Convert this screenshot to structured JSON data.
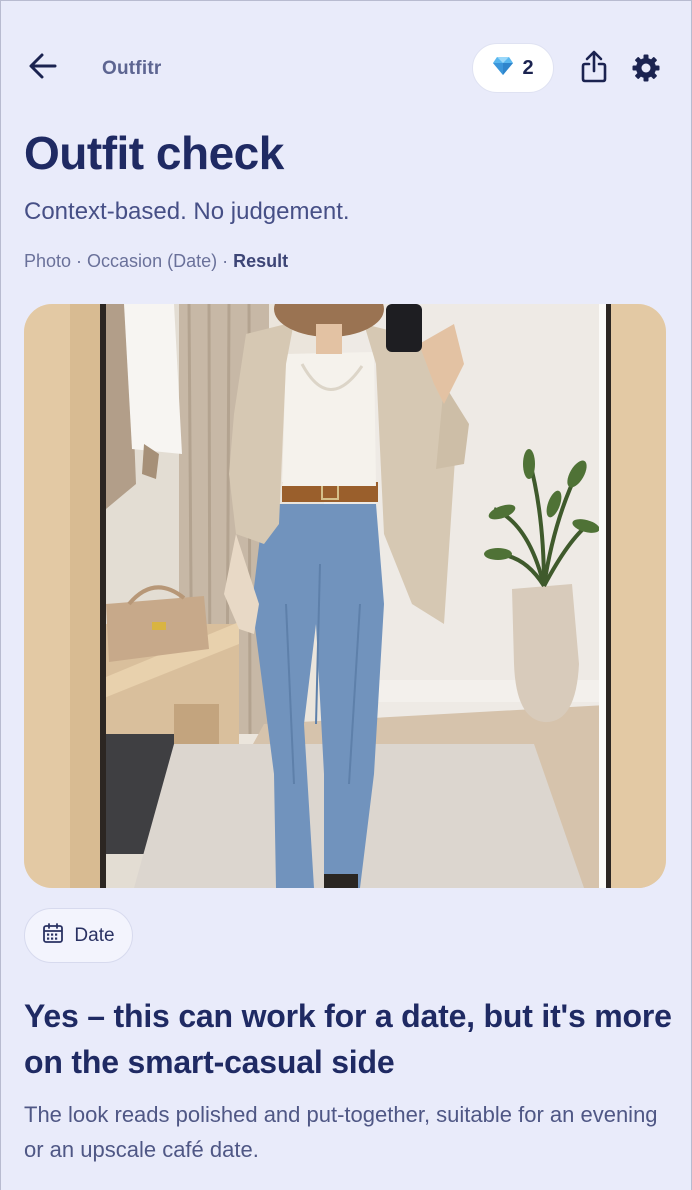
{
  "header": {
    "app_name": "Outfitr",
    "gem_count": "2",
    "back_icon": "arrow-left-icon",
    "gem_icon": "diamond-icon",
    "share_icon": "share-icon",
    "settings_icon": "gear-icon"
  },
  "page": {
    "title": "Outfit check",
    "subtitle": "Context-based. No judgement.",
    "breadcrumb": {
      "step1": "Photo",
      "sep": " · ",
      "step2": "Occasion (Date)",
      "step3": "Result"
    }
  },
  "photo": {
    "description_icon": "outfit-photo"
  },
  "occasion_chip": {
    "icon": "calendar-icon",
    "label": "Date"
  },
  "result": {
    "verdict": "Yes – this can work for a date, but it's more on the smart-casual side",
    "explanation": "The look reads polished and put-together, suitable for an evening or an upscale café date."
  },
  "colors": {
    "background": "#e9ebfa",
    "primary_text": "#1f2a63",
    "secondary_text": "#4f5785",
    "gem": "#4aa8e8"
  }
}
